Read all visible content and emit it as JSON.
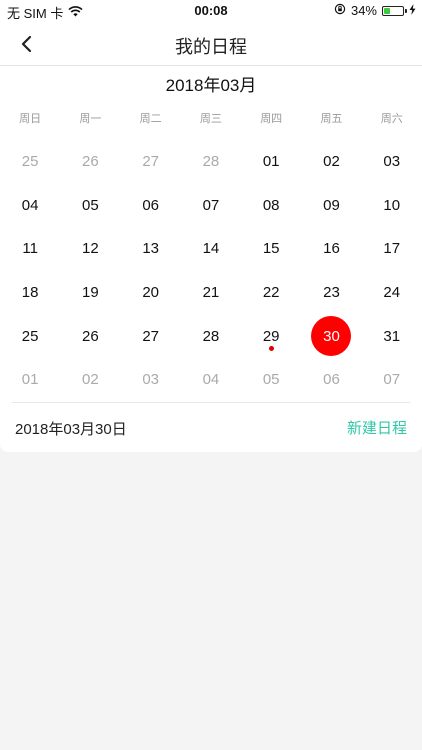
{
  "status_bar": {
    "carrier": "无 SIM 卡",
    "time": "00:08",
    "battery_percent_label": "34%",
    "battery_level": 0.34
  },
  "nav": {
    "title": "我的日程"
  },
  "calendar": {
    "month_title": "2018年03月",
    "weekdays": [
      "周日",
      "周一",
      "周二",
      "周三",
      "周四",
      "周五",
      "周六"
    ],
    "weeks": [
      [
        {
          "label": "25",
          "muted": true
        },
        {
          "label": "26",
          "muted": true
        },
        {
          "label": "27",
          "muted": true
        },
        {
          "label": "28",
          "muted": true
        },
        {
          "label": "01"
        },
        {
          "label": "02"
        },
        {
          "label": "03"
        }
      ],
      [
        {
          "label": "04"
        },
        {
          "label": "05"
        },
        {
          "label": "06"
        },
        {
          "label": "07"
        },
        {
          "label": "08"
        },
        {
          "label": "09"
        },
        {
          "label": "10"
        }
      ],
      [
        {
          "label": "11"
        },
        {
          "label": "12"
        },
        {
          "label": "13"
        },
        {
          "label": "14"
        },
        {
          "label": "15"
        },
        {
          "label": "16"
        },
        {
          "label": "17"
        }
      ],
      [
        {
          "label": "18"
        },
        {
          "label": "19"
        },
        {
          "label": "20"
        },
        {
          "label": "21"
        },
        {
          "label": "22"
        },
        {
          "label": "23"
        },
        {
          "label": "24"
        }
      ],
      [
        {
          "label": "25"
        },
        {
          "label": "26"
        },
        {
          "label": "27"
        },
        {
          "label": "28"
        },
        {
          "label": "29",
          "has_event": true
        },
        {
          "label": "30",
          "selected": true
        },
        {
          "label": "31"
        }
      ],
      [
        {
          "label": "01",
          "muted": true
        },
        {
          "label": "02",
          "muted": true
        },
        {
          "label": "03",
          "muted": true
        },
        {
          "label": "04",
          "muted": true
        },
        {
          "label": "05",
          "muted": true
        },
        {
          "label": "06",
          "muted": true
        },
        {
          "label": "07",
          "muted": true
        }
      ]
    ],
    "selected_date_label": "2018年03月30日",
    "new_event_label": "新建日程",
    "colors": {
      "selected": "#ff0000",
      "event_dot": "#e00000",
      "accent": "#2fc8a8"
    }
  }
}
